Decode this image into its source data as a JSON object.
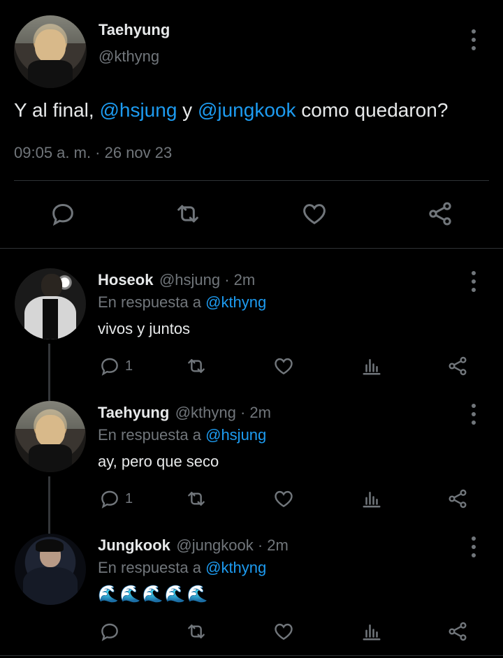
{
  "main_tweet": {
    "author_name": "Taehyung",
    "handle": "@kthyng",
    "text_prefix": "Y al final, ",
    "mention1": "@hsjung",
    "text_mid": " y ",
    "mention2": "@jungkook",
    "text_suffix": " como quedaron?",
    "timestamp": "09:05 a. m. · 26 nov 23"
  },
  "replies": [
    {
      "author_name": "Hoseok",
      "handle_time": "@hsjung · 2m",
      "reply_prefix": "En respuesta a ",
      "reply_to": "@kthyng",
      "text": "vivos y juntos",
      "reply_count": "1"
    },
    {
      "author_name": "Taehyung",
      "handle_time": "@kthyng · 2m",
      "reply_prefix": "En respuesta a ",
      "reply_to": "@hsjung",
      "text": "ay, pero que seco",
      "reply_count": "1"
    },
    {
      "author_name": "Jungkook",
      "handle_time": "@jungkook · 2m",
      "reply_prefix": "En respuesta a ",
      "reply_to": "@kthyng",
      "text": "🌊🌊🌊🌊🌊",
      "reply_count": ""
    }
  ],
  "colors": {
    "background": "#000000",
    "text": "#e7e9ea",
    "secondary": "#71767b",
    "accent": "#1d9bf0"
  },
  "icons": [
    "reply-icon",
    "retweet-icon",
    "like-icon",
    "share-icon",
    "views-icon",
    "more-icon"
  ]
}
